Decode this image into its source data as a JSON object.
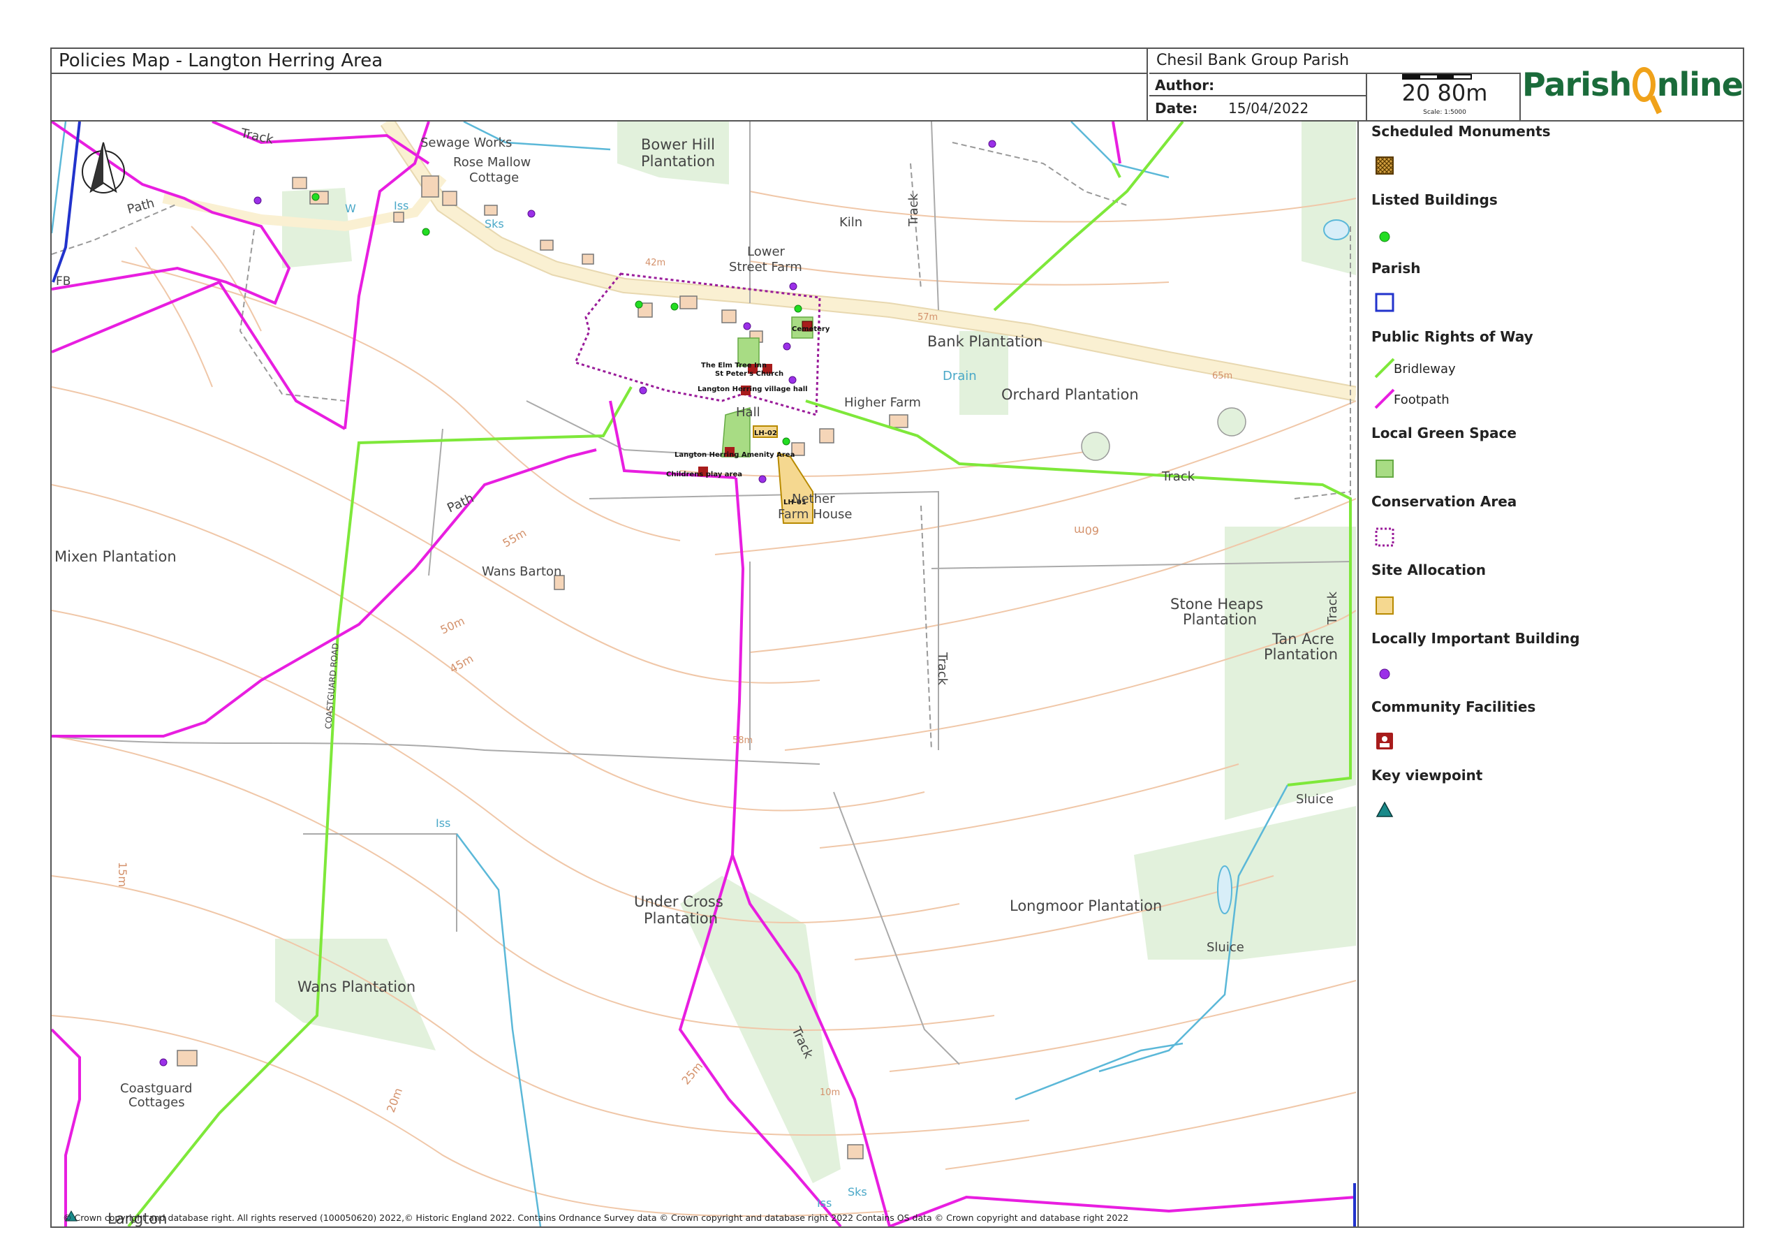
{
  "header": {
    "title": "Policies Map - Langton Herring Area",
    "parish": "Chesil Bank Group Parish",
    "author_label": "Author:",
    "date_label": "Date:",
    "date_value": "15/04/2022",
    "scale_text": "20 80m",
    "scale_ratio": "Scale: 1:5000",
    "logo_text_left": "Parish",
    "logo_text_right": "nline"
  },
  "legend": {
    "items": [
      {
        "heading": "Scheduled Monuments",
        "symbol": "hatched-square"
      },
      {
        "heading": "Listed Buildings",
        "symbol": "green-dot"
      },
      {
        "heading": "Parish",
        "symbol": "blue-square"
      },
      {
        "heading": "Public Rights of Way",
        "sub": [
          "Bridleway",
          "Footpath"
        ]
      },
      {
        "heading": "Local Green Space",
        "symbol": "green-square"
      },
      {
        "heading": "Conservation Area",
        "symbol": "dotted-square"
      },
      {
        "heading": "Site Allocation",
        "symbol": "orange-square"
      },
      {
        "heading": "Locally Important Building",
        "symbol": "purple-dot"
      },
      {
        "heading": "Community Facilities",
        "symbol": "facility-icon"
      },
      {
        "heading": "Key viewpoint",
        "symbol": "teal-triangle"
      }
    ],
    "colors": {
      "bridleway": "#7ee83a",
      "footpath": "#e81ee0",
      "listed": "#22dd22",
      "lib": "#9b30e8",
      "green_space": "#a8dc84",
      "site_alloc": "#f5d890",
      "parish": "#2233cc",
      "viewpoint": "#1a8a8a"
    }
  },
  "map_labels": {
    "track1": "Track",
    "sewage": "Sewage Works",
    "rose1": "Rose Mallow",
    "rose2": "Cottage",
    "bower1": "Bower Hill",
    "bower2": "Plantation",
    "iss": "Iss",
    "sks": "Sks",
    "w": "W",
    "path": "Path",
    "fb": "FB",
    "kiln": "Kiln",
    "track": "Track",
    "lower1": "Lower",
    "lower2": "Street Farm",
    "c42": "42m",
    "bank": "Bank Plantation",
    "c57": "57m",
    "c65": "65m",
    "c60": "60m",
    "drain": "Drain",
    "orchard": "Orchard Plantation",
    "higher": "Higher Farm",
    "hall": "Hall",
    "cemetery": "Cemetery",
    "elm": "The Elm Tree Inn",
    "peter": "St Peter's Church",
    "village_hall": "Langton Herring village hall",
    "amenity": "Langton Herring Amenity Area",
    "play": "Childrens play area",
    "lh02": "LH-02",
    "lh01": "LH-01",
    "nether1": "Nether",
    "nether2": "Farm House",
    "mixen": "Mixen Plantation",
    "wans_barton": "Wans Barton",
    "c55": "55m",
    "c50": "50m",
    "c45": "45m",
    "coastguard_road": "COASTGUARD ROAD",
    "stone1": "Stone Heaps",
    "stone2": "Plantation",
    "tan1": "Tan Acre",
    "tan2": "Plantation",
    "c58": "58m",
    "sluice": "Sluice",
    "under1": "Under Cross",
    "under2": "Plantation",
    "longmoor": "Longmoor Plantation",
    "wans_plant": "Wans Plantation",
    "c15": "15m",
    "c20": "20m",
    "c25": "25m",
    "c10": "10m",
    "coast1": "Coastguard",
    "coast2": "Cottages",
    "langton": "Langton"
  },
  "copyright": "© Crown copyright and database right. All rights reserved (100050620) 2022,© Historic England 2022. Contains Ordnance Survey data © Crown copyright and database right 2022 Contains OS data © Crown copyright and database right 2022"
}
